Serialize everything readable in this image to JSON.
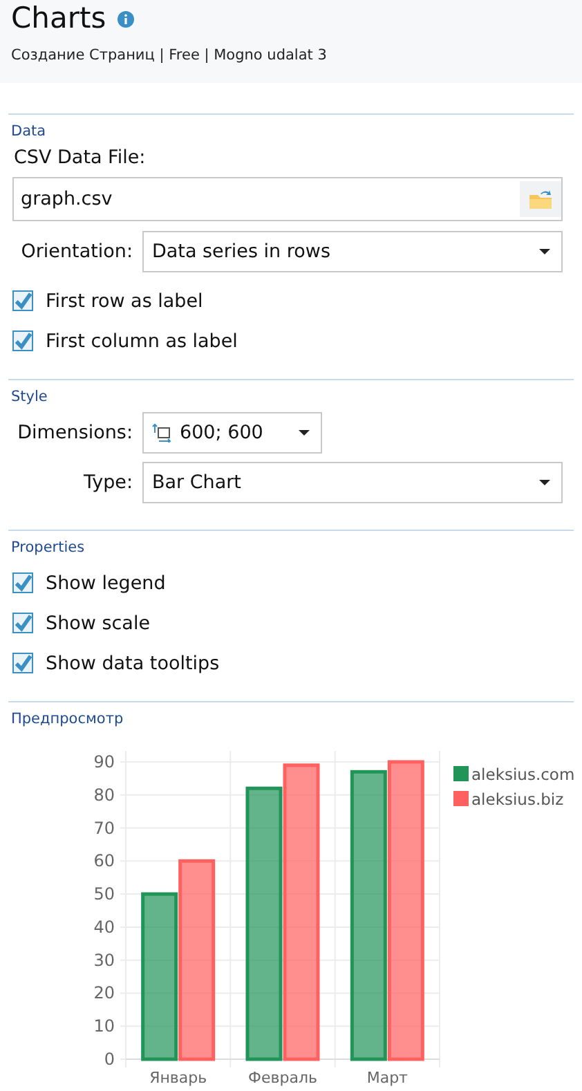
{
  "header": {
    "title": "Charts",
    "subtitle": "Создание Страниц | Free | Mogno udalat 3"
  },
  "sections": [
    {
      "title": "Data",
      "rows": [
        {
          "kind": "label",
          "text": "CSV Data File:"
        },
        {
          "kind": "file",
          "value": "graph.csv"
        },
        {
          "kind": "select",
          "label": "Orientation:",
          "value": "Data series in rows"
        },
        {
          "kind": "checkbox",
          "label": "First row as label",
          "checked": true
        },
        {
          "kind": "checkbox",
          "label": "First column as label",
          "checked": true
        }
      ]
    },
    {
      "title": "Style",
      "rows": [
        {
          "kind": "size",
          "label": "Dimensions:",
          "value": "600; 600"
        },
        {
          "kind": "select",
          "label": "Type:",
          "value": "Bar Chart"
        }
      ]
    },
    {
      "title": "Properties",
      "rows": [
        {
          "kind": "checkbox",
          "label": "Show legend",
          "checked": true
        },
        {
          "kind": "checkbox",
          "label": "Show scale",
          "checked": true
        },
        {
          "kind": "checkbox",
          "label": "Show data tooltips",
          "checked": true
        }
      ]
    }
  ],
  "preview": {
    "title": "Предпросмотр",
    "chart_data": {
      "type": "bar",
      "categories": [
        "Январь",
        "Февраль",
        "Март"
      ],
      "series": [
        {
          "name": "aleksius.com",
          "color": "#219458",
          "values": [
            50,
            82,
            87
          ]
        },
        {
          "name": "aleksius.biz",
          "color": "#ff6060",
          "values": [
            60,
            89,
            90
          ]
        }
      ],
      "ylim": [
        0,
        90
      ],
      "grid": true,
      "legend": "right",
      "yticks": [
        0,
        10,
        20,
        30,
        40,
        50,
        60,
        70,
        80,
        90
      ]
    }
  }
}
